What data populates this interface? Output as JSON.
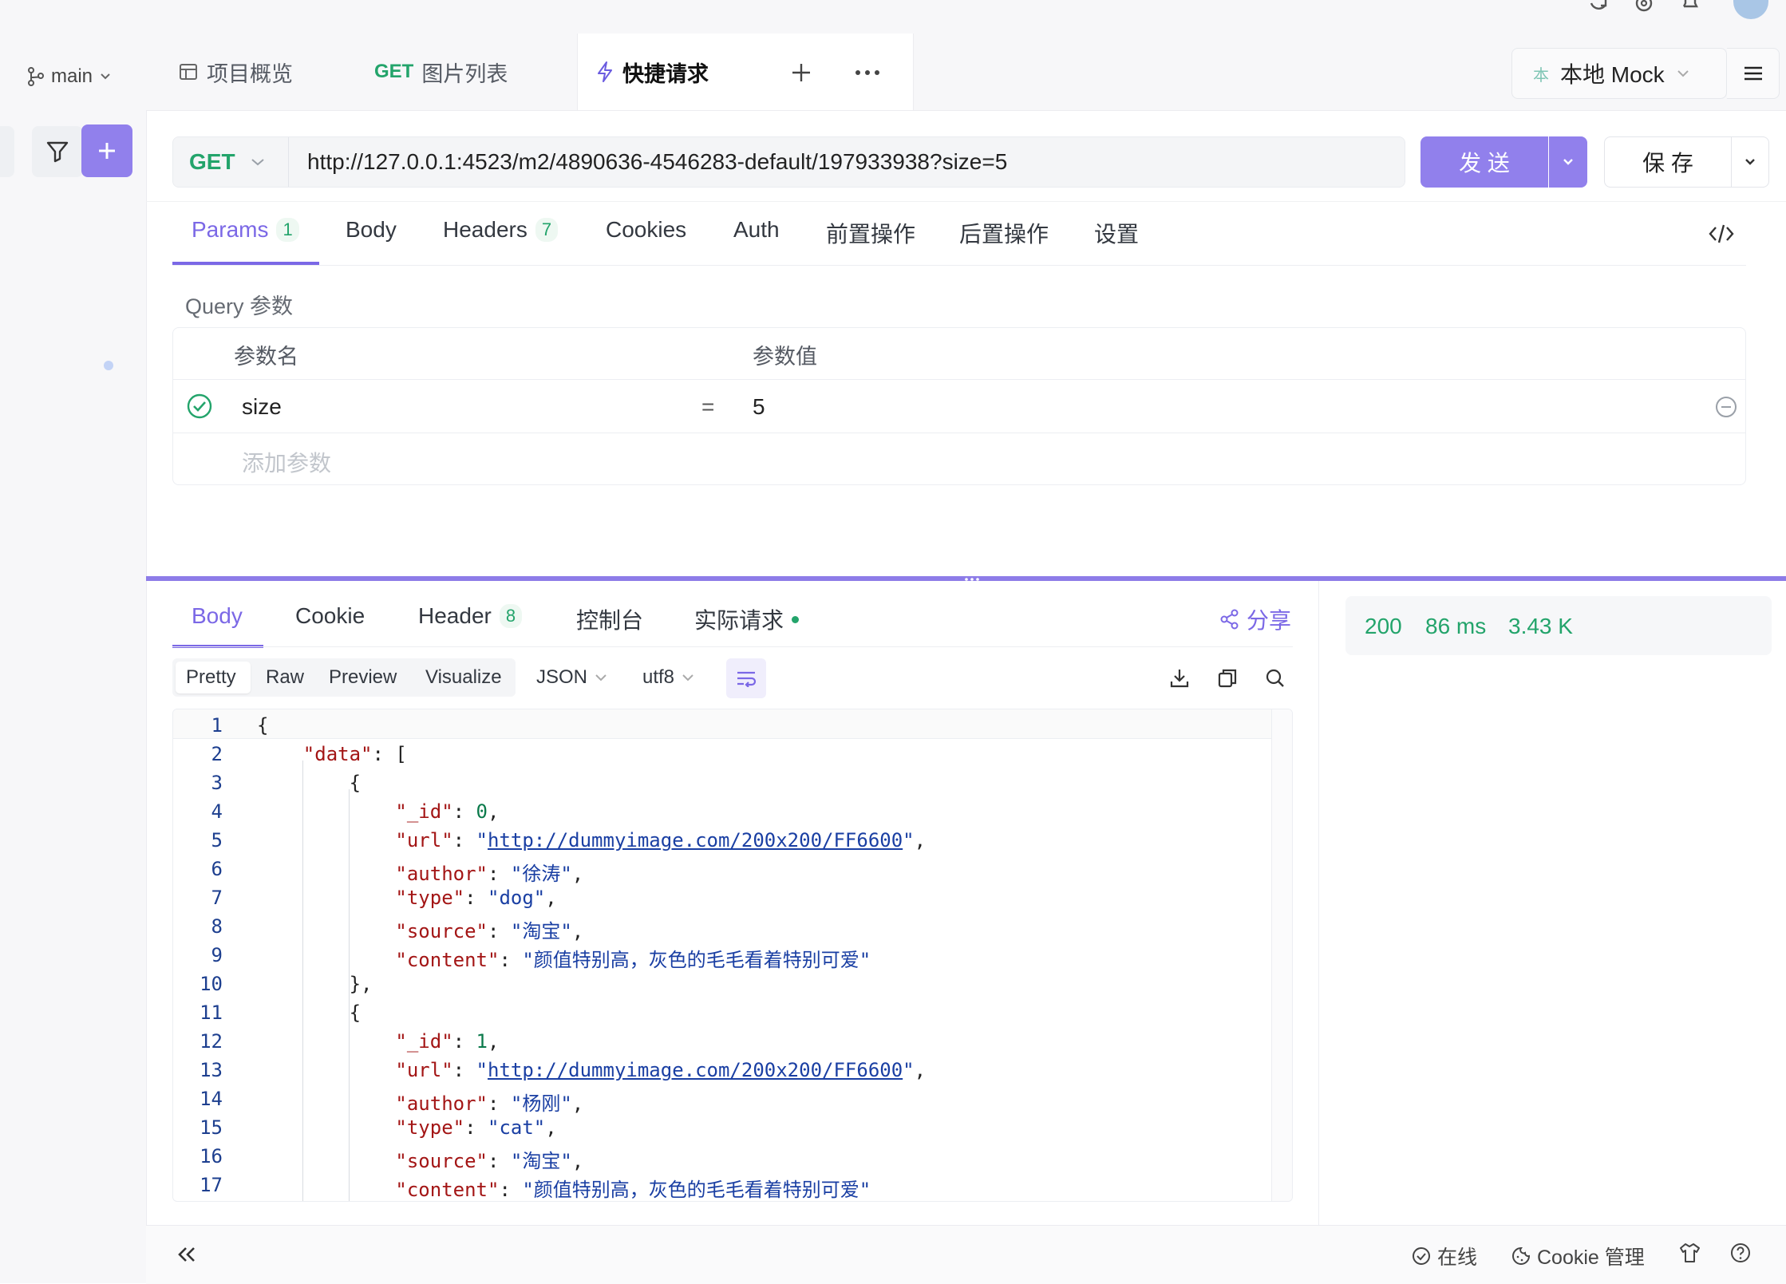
{
  "branch": {
    "label": "main"
  },
  "tabs": [
    {
      "label": "项目概览",
      "method": ""
    },
    {
      "label": "图片列表",
      "method": "GET"
    },
    {
      "label": "快捷请求",
      "method": ""
    }
  ],
  "env": {
    "badge": "本",
    "label": "本地 Mock"
  },
  "request": {
    "method": "GET",
    "url": "http://127.0.0.1:4523/m2/4890636-4546283-default/197933938?size=5",
    "send_label": "发 送",
    "save_label": "保 存"
  },
  "request_tabs": [
    {
      "label": "Params",
      "count": "1"
    },
    {
      "label": "Body",
      "count": ""
    },
    {
      "label": "Headers",
      "count": "7"
    },
    {
      "label": "Cookies",
      "count": ""
    },
    {
      "label": "Auth",
      "count": ""
    },
    {
      "label": "前置操作",
      "count": ""
    },
    {
      "label": "后置操作",
      "count": ""
    },
    {
      "label": "设置",
      "count": ""
    }
  ],
  "query": {
    "section_title": "Query 参数",
    "col_name": "参数名",
    "col_value": "参数值",
    "rows": [
      {
        "name": "size",
        "eq": "=",
        "value": "5"
      }
    ],
    "add_placeholder": "添加参数"
  },
  "response_tabs": [
    {
      "label": "Body",
      "count": ""
    },
    {
      "label": "Cookie",
      "count": ""
    },
    {
      "label": "Header",
      "count": "8"
    },
    {
      "label": "控制台",
      "count": ""
    },
    {
      "label": "实际请求",
      "count": ""
    }
  ],
  "share_label": "分享",
  "format": {
    "modes": [
      "Pretty",
      "Raw",
      "Preview",
      "Visualize"
    ],
    "lang": "JSON",
    "encoding": "utf8"
  },
  "status": {
    "code": "200",
    "time": "86 ms",
    "size": "3.43 K"
  },
  "code_lines": [
    "{",
    "    \"data\": [",
    "        {",
    "            \"_id\": 0,",
    "            \"url\": \"http://dummyimage.com/200x200/FF6600\",",
    "            \"author\": \"徐涛\",",
    "            \"type\": \"dog\",",
    "            \"source\": \"淘宝\",",
    "            \"content\": \"颜值特别高，灰色的毛毛看着特别可爱\"",
    "        },",
    "        {",
    "            \"_id\": 1,",
    "            \"url\": \"http://dummyimage.com/200x200/FF6600\",",
    "            \"author\": \"杨刚\",",
    "            \"type\": \"cat\",",
    "            \"source\": \"淘宝\",",
    "            \"content\": \"颜值特别高，灰色的毛毛看着特别可爱\""
  ],
  "bottom": {
    "online_label": "在线",
    "cookie_label": "Cookie 管理"
  },
  "colors": {
    "accent": "#8d7ce8",
    "send": "#9180ec",
    "success": "#23a46b"
  }
}
